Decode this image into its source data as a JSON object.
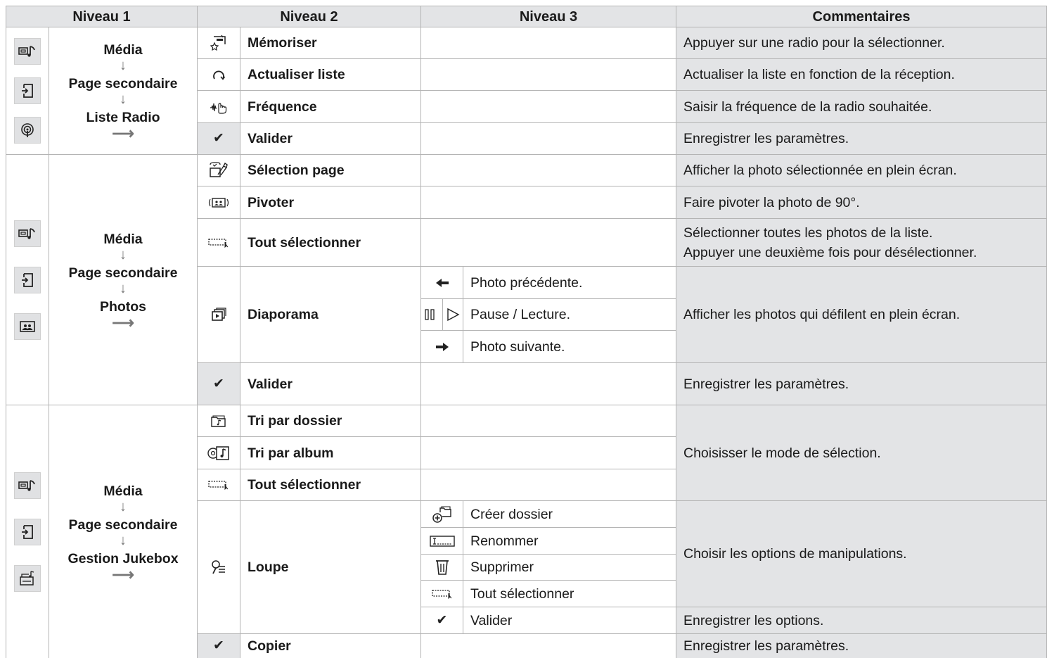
{
  "header": {
    "niveau1": "Niveau 1",
    "niveau2": "Niveau 2",
    "niveau3": "Niveau 3",
    "commentaires": "Commentaires"
  },
  "sections": [
    {
      "path": [
        "Média",
        "Page secondaire",
        "Liste Radio"
      ],
      "icons": [
        "media-icon",
        "secondary-page-icon",
        "radio-list-icon"
      ],
      "rows": [
        {
          "icon": "memorise-icon",
          "label": "Mémoriser",
          "comment": "Appuyer sur une radio pour la sélectionner."
        },
        {
          "icon": "refresh-icon",
          "label": "Actualiser liste",
          "comment": "Actualiser la liste en fonction de la réception."
        },
        {
          "icon": "frequency-icon",
          "label": "Fréquence",
          "comment": "Saisir la fréquence de la radio souhaitée."
        },
        {
          "icon": "checkmark-icon",
          "label": "Valider",
          "comment": "Enregistrer les paramètres."
        }
      ]
    },
    {
      "path": [
        "Média",
        "Page secondaire",
        "Photos"
      ],
      "icons": [
        "media-icon",
        "secondary-page-icon",
        "photos-icon"
      ],
      "rows": [
        {
          "icon": "page-select-icon",
          "label": "Sélection page",
          "comment": "Afficher la photo sélectionnée en plein écran."
        },
        {
          "icon": "rotate-icon",
          "label": "Pivoter",
          "comment": "Faire pivoter la photo de 90°."
        },
        {
          "icon": "select-all-icon",
          "label": "Tout sélectionner",
          "comment_line1": "Sélectionner toutes les photos de la liste.",
          "comment_line2": "Appuyer une deuxième fois pour désélectionner."
        },
        {
          "icon": "slideshow-icon",
          "label": "Diaporama",
          "comment": "Afficher les photos qui défilent en plein écran.",
          "sub": [
            {
              "icon": "arrow-left-icon",
              "label": "Photo précédente."
            },
            {
              "icon": "pause-play-icon",
              "label": "Pause / Lecture."
            },
            {
              "icon": "arrow-right-icon",
              "label": "Photo suivante."
            }
          ]
        },
        {
          "icon": "checkmark-icon",
          "label": "Valider",
          "comment": "Enregistrer les paramètres."
        }
      ]
    },
    {
      "path": [
        "Média",
        "Page secondaire",
        "Gestion Jukebox"
      ],
      "icons": [
        "media-icon",
        "secondary-page-icon",
        "jukebox-icon"
      ],
      "rows": [
        {
          "icon": "folder-sort-icon",
          "label": "Tri par dossier"
        },
        {
          "icon": "album-sort-icon",
          "label": "Tri par album"
        },
        {
          "icon": "select-all-icon",
          "label": "Tout sélectionner"
        },
        {
          "icon": "magnifier-icon",
          "label": "Loupe",
          "sub": [
            {
              "icon": "create-folder-icon",
              "label": "Créer dossier"
            },
            {
              "icon": "rename-icon",
              "label": "Renommer"
            },
            {
              "icon": "trash-icon",
              "label": "Supprimer"
            },
            {
              "icon": "select-all-icon",
              "label": "Tout sélectionner"
            },
            {
              "icon": "checkmark-icon",
              "label": "Valider"
            }
          ]
        },
        {
          "icon": "checkmark-icon",
          "label": "Copier",
          "comment": "Enregistrer les paramètres."
        }
      ],
      "comment_sort": "Choisisser le mode de sélection.",
      "comment_loupe": "Choisir les options de manipulations.",
      "comment_valider": "Enregistrer les options."
    }
  ],
  "glyphs": {
    "check": "✔",
    "arrow_left": "🡐",
    "arrow_right": "➔",
    "arrow_down": "↓",
    "arrow_right_thin": "⟶"
  },
  "colors": {
    "header_bg": "#e3e4e6",
    "comment_bg": "#e3e4e6",
    "border": "#b4b4b4"
  }
}
